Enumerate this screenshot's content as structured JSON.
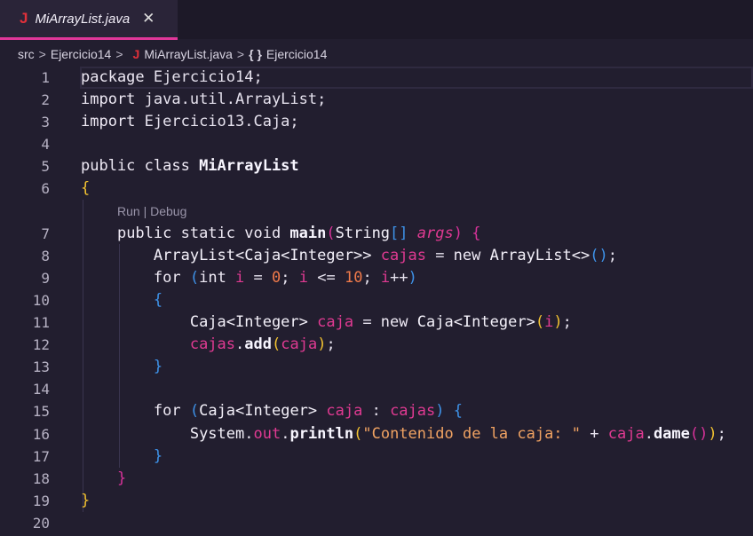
{
  "tab": {
    "icon": "java-icon",
    "label": "MiArrayList.java",
    "close": "✕"
  },
  "breadcrumb": [
    "src",
    "Ejercicio14",
    "MiArrayList.java",
    "Ejercicio14"
  ],
  "codelens": {
    "run": "Run",
    "sep": " | ",
    "debug": "Debug"
  },
  "colors": {
    "accent": "#e0379a",
    "background": "#221e2f"
  },
  "lines": [
    {
      "n": "1",
      "t": [
        [
          "kw",
          "package "
        ],
        [
          "pl",
          "Ejercicio14;"
        ]
      ]
    },
    {
      "n": "2",
      "t": [
        [
          "kw",
          "import "
        ],
        [
          "pl",
          "java.util.ArrayList;"
        ]
      ]
    },
    {
      "n": "3",
      "t": [
        [
          "kw",
          "import "
        ],
        [
          "pl",
          "Ejercicio13.Caja;"
        ]
      ]
    },
    {
      "n": "4",
      "t": []
    },
    {
      "n": "5",
      "t": [
        [
          "kw",
          "public class "
        ],
        [
          "fn",
          "MiArrayList"
        ]
      ]
    },
    {
      "n": "6",
      "t": [
        [
          "b1",
          "{"
        ]
      ]
    },
    {
      "lens": true
    },
    {
      "n": "7",
      "t": [
        [
          "pl",
          "    "
        ],
        [
          "kw",
          "public static void "
        ],
        [
          "fn",
          "main"
        ],
        [
          "b2",
          "("
        ],
        [
          "ty",
          "String"
        ],
        [
          "b3",
          "[]"
        ],
        [
          "pl",
          " "
        ],
        [
          "it",
          "args"
        ],
        [
          "b2",
          ")"
        ],
        [
          "pl",
          " "
        ],
        [
          "b2",
          "{"
        ]
      ]
    },
    {
      "n": "8",
      "t": [
        [
          "pl",
          "        "
        ],
        [
          "ty",
          "ArrayList<Caja<Integer>> "
        ],
        [
          "va",
          "cajas"
        ],
        [
          "pl",
          " = "
        ],
        [
          "kw",
          "new "
        ],
        [
          "ty",
          "ArrayList<>"
        ],
        [
          "b3",
          "()"
        ],
        [
          "pl",
          ";"
        ]
      ]
    },
    {
      "n": "9",
      "t": [
        [
          "pl",
          "        "
        ],
        [
          "kw",
          "for "
        ],
        [
          "b3",
          "("
        ],
        [
          "kw",
          "int "
        ],
        [
          "va",
          "i"
        ],
        [
          "pl",
          " = "
        ],
        [
          "nu",
          "0"
        ],
        [
          "pl",
          "; "
        ],
        [
          "va",
          "i"
        ],
        [
          "pl",
          " <= "
        ],
        [
          "nu",
          "10"
        ],
        [
          "pl",
          "; "
        ],
        [
          "va",
          "i"
        ],
        [
          "pl",
          "++"
        ],
        [
          "b3",
          ")"
        ]
      ]
    },
    {
      "n": "10",
      "t": [
        [
          "pl",
          "        "
        ],
        [
          "b3",
          "{"
        ]
      ]
    },
    {
      "n": "11",
      "t": [
        [
          "pl",
          "            "
        ],
        [
          "ty",
          "Caja<Integer> "
        ],
        [
          "va",
          "caja"
        ],
        [
          "pl",
          " = "
        ],
        [
          "kw",
          "new "
        ],
        [
          "ty",
          "Caja<Integer>"
        ],
        [
          "b1",
          "("
        ],
        [
          "va",
          "i"
        ],
        [
          "b1",
          ")"
        ],
        [
          "pl",
          ";"
        ]
      ]
    },
    {
      "n": "12",
      "t": [
        [
          "pl",
          "            "
        ],
        [
          "va",
          "cajas"
        ],
        [
          "pl",
          "."
        ],
        [
          "fn",
          "add"
        ],
        [
          "b1",
          "("
        ],
        [
          "va",
          "caja"
        ],
        [
          "b1",
          ")"
        ],
        [
          "pl",
          ";"
        ]
      ]
    },
    {
      "n": "13",
      "t": [
        [
          "pl",
          "        "
        ],
        [
          "b3",
          "}"
        ]
      ]
    },
    {
      "n": "14",
      "t": []
    },
    {
      "n": "15",
      "t": [
        [
          "pl",
          "        "
        ],
        [
          "kw",
          "for "
        ],
        [
          "b3",
          "("
        ],
        [
          "ty",
          "Caja<Integer> "
        ],
        [
          "va",
          "caja"
        ],
        [
          "pl",
          " : "
        ],
        [
          "va",
          "cajas"
        ],
        [
          "b3",
          ")"
        ],
        [
          "pl",
          " "
        ],
        [
          "b3",
          "{"
        ]
      ]
    },
    {
      "n": "16",
      "t": [
        [
          "pl",
          "            "
        ],
        [
          "ty",
          "System"
        ],
        [
          "pl",
          "."
        ],
        [
          "va",
          "out"
        ],
        [
          "pl",
          "."
        ],
        [
          "fn",
          "println"
        ],
        [
          "b1",
          "("
        ],
        [
          "st",
          "\"Contenido de la caja: \""
        ],
        [
          "pl",
          " + "
        ],
        [
          "va",
          "caja"
        ],
        [
          "pl",
          "."
        ],
        [
          "fn",
          "dame"
        ],
        [
          "b2",
          "()"
        ],
        [
          "b1",
          ")"
        ],
        [
          "pl",
          ";"
        ]
      ]
    },
    {
      "n": "17",
      "t": [
        [
          "pl",
          "        "
        ],
        [
          "b3",
          "}"
        ]
      ]
    },
    {
      "n": "18",
      "t": [
        [
          "pl",
          "    "
        ],
        [
          "b2",
          "}"
        ]
      ]
    },
    {
      "n": "19",
      "t": [
        [
          "b1",
          "}"
        ]
      ]
    },
    {
      "n": "20",
      "t": []
    }
  ]
}
